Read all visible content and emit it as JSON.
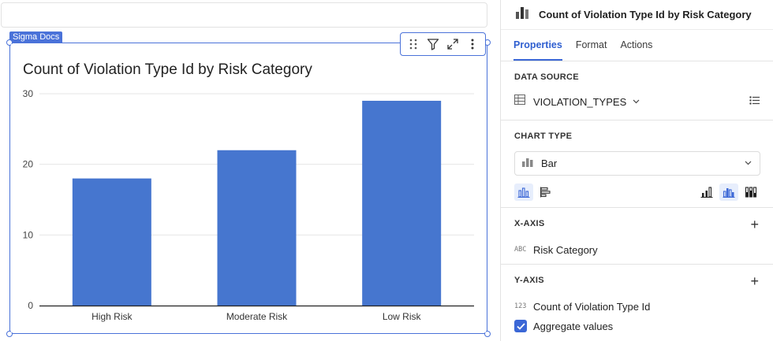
{
  "workbook": {
    "element_tag": "Sigma Docs"
  },
  "chart_data": {
    "type": "bar",
    "title": "Count of Violation Type Id by Risk Category",
    "categories": [
      "High Risk",
      "Moderate Risk",
      "Low Risk"
    ],
    "values": [
      18,
      22,
      29
    ],
    "ylim": [
      0,
      30
    ],
    "yticks": [
      "0",
      "10",
      "20",
      "30"
    ],
    "grid": true,
    "color": "#4676cf"
  },
  "toolbar": {
    "icons": [
      "drag-handle-icon",
      "filter-icon",
      "expand-icon",
      "more-vertical-icon"
    ]
  },
  "properties": {
    "title": "Count of Violation Type Id by Risk Category",
    "tabs": [
      {
        "label": "Properties",
        "active": true
      },
      {
        "label": "Format",
        "active": false
      },
      {
        "label": "Actions",
        "active": false
      }
    ],
    "data_source": {
      "label": "DATA SOURCE",
      "name": "VIOLATION_TYPES"
    },
    "chart_type": {
      "label": "CHART TYPE",
      "value": "Bar"
    },
    "x_axis": {
      "label": "X-AXIS",
      "field_type": "ABC",
      "field": "Risk Category"
    },
    "y_axis": {
      "label": "Y-AXIS",
      "field_type": "123",
      "field": "Count of Violation Type Id",
      "aggregate_label": "Aggregate values",
      "aggregate_checked": true
    },
    "accent_color": "#3b67d6"
  }
}
